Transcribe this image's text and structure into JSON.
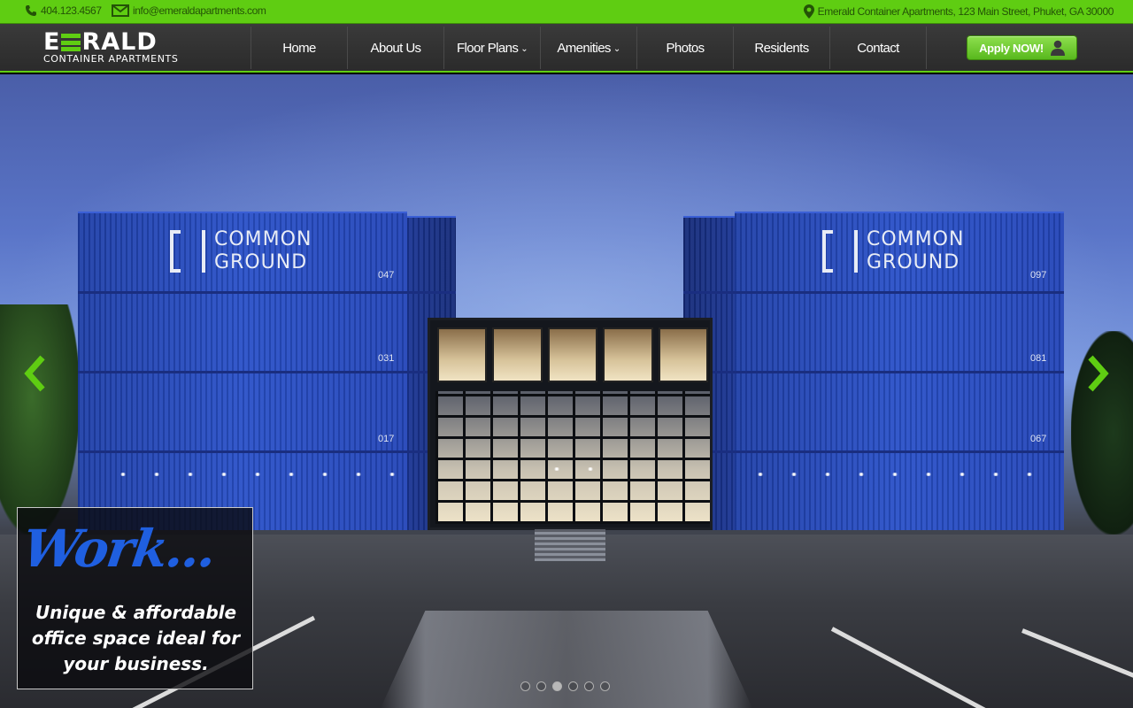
{
  "topbar": {
    "phone": "404.123.4567",
    "email": "info@emeraldapartments.com",
    "address": "Emerald Container Apartments, 123 Main Street, Phuket, GA 30000",
    "icons": [
      "phone-icon",
      "envelope-icon",
      "map-pin-icon"
    ]
  },
  "logo": {
    "word_before": "E",
    "word_after": "RALD",
    "subtitle": "CONTAINER APARTMENTS"
  },
  "nav": {
    "items": [
      {
        "label": "Home",
        "dropdown": false
      },
      {
        "label": "About Us",
        "dropdown": false
      },
      {
        "label": "Floor Plans",
        "dropdown": true
      },
      {
        "label": "Amenities",
        "dropdown": true
      },
      {
        "label": "Photos",
        "dropdown": false
      },
      {
        "label": "Residents",
        "dropdown": false
      },
      {
        "label": "Contact",
        "dropdown": false
      }
    ],
    "chevron": "⌄",
    "apply_label": "Apply NOW!"
  },
  "hero": {
    "building_sign_line1": "COMMON",
    "building_sign_line2": "GROUND",
    "container_numbers": [
      "047",
      "031",
      "017",
      "097",
      "081",
      "067"
    ],
    "caption_script": "Work...",
    "caption_text": "Unique & affordable office space ideal for your business.",
    "slide_count": 6,
    "active_slide": 3,
    "prev_arrow": "‹",
    "next_arrow": "›"
  },
  "colors": {
    "brand_green": "#5fcd12",
    "nav_bg": "#333333",
    "caption_script_blue": "#1f5fe0"
  }
}
